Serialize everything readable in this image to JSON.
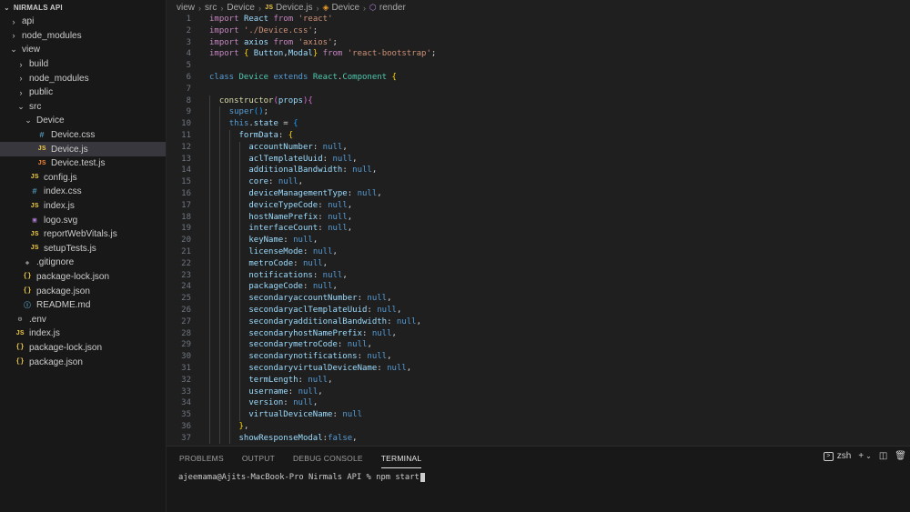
{
  "explorer": {
    "title": "NIRMALS API",
    "items": [
      {
        "label": "api",
        "depth": 1,
        "type": "folder",
        "open": false
      },
      {
        "label": "node_modules",
        "depth": 1,
        "type": "folder",
        "open": false
      },
      {
        "label": "view",
        "depth": 1,
        "type": "folder",
        "open": true
      },
      {
        "label": "build",
        "depth": 2,
        "type": "folder",
        "open": false
      },
      {
        "label": "node_modules",
        "depth": 2,
        "type": "folder",
        "open": false
      },
      {
        "label": "public",
        "depth": 2,
        "type": "folder",
        "open": false
      },
      {
        "label": "src",
        "depth": 2,
        "type": "folder",
        "open": true
      },
      {
        "label": "Device",
        "depth": 3,
        "type": "folder",
        "open": true
      },
      {
        "label": "Device.css",
        "depth": 4,
        "type": "css"
      },
      {
        "label": "Device.js",
        "depth": 4,
        "type": "js",
        "selected": true
      },
      {
        "label": "Device.test.js",
        "depth": 4,
        "type": "test"
      },
      {
        "label": "config.js",
        "depth": 3,
        "type": "js"
      },
      {
        "label": "index.css",
        "depth": 3,
        "type": "css"
      },
      {
        "label": "index.js",
        "depth": 3,
        "type": "js"
      },
      {
        "label": "logo.svg",
        "depth": 3,
        "type": "svg"
      },
      {
        "label": "reportWebVitals.js",
        "depth": 3,
        "type": "js"
      },
      {
        "label": "setupTests.js",
        "depth": 3,
        "type": "js"
      },
      {
        "label": ".gitignore",
        "depth": 2,
        "type": "git"
      },
      {
        "label": "package-lock.json",
        "depth": 2,
        "type": "json"
      },
      {
        "label": "package.json",
        "depth": 2,
        "type": "json"
      },
      {
        "label": "README.md",
        "depth": 2,
        "type": "info"
      },
      {
        "label": ".env",
        "depth": 1,
        "type": "env"
      },
      {
        "label": "index.js",
        "depth": 1,
        "type": "js"
      },
      {
        "label": "package-lock.json",
        "depth": 1,
        "type": "json"
      },
      {
        "label": "package.json",
        "depth": 1,
        "type": "json"
      }
    ]
  },
  "breadcrumb": {
    "parts": [
      "view",
      "src",
      "Device"
    ],
    "file": "Device.js",
    "class": "Device",
    "method": "render"
  },
  "code_lines": [
    [
      [
        "kw2",
        "import"
      ],
      [
        "p",
        " "
      ],
      [
        "v",
        "React"
      ],
      [
        "p",
        " "
      ],
      [
        "kw2",
        "from"
      ],
      [
        "p",
        " "
      ],
      [
        "s",
        "'react'"
      ]
    ],
    [
      [
        "kw2",
        "import"
      ],
      [
        "p",
        " "
      ],
      [
        "s",
        "'./Device.css'"
      ],
      [
        "p",
        ";"
      ]
    ],
    [
      [
        "kw2",
        "import"
      ],
      [
        "p",
        " "
      ],
      [
        "v",
        "axios"
      ],
      [
        "p",
        " "
      ],
      [
        "kw2",
        "from"
      ],
      [
        "p",
        " "
      ],
      [
        "s",
        "'axios'"
      ],
      [
        "p",
        ";"
      ]
    ],
    [
      [
        "kw2",
        "import"
      ],
      [
        "p",
        " "
      ],
      [
        "b1",
        "{"
      ],
      [
        "p",
        " "
      ],
      [
        "v",
        "Button"
      ],
      [
        "p",
        ","
      ],
      [
        "v",
        "Modal"
      ],
      [
        "b1",
        "}"
      ],
      [
        "p",
        " "
      ],
      [
        "kw2",
        "from"
      ],
      [
        "p",
        " "
      ],
      [
        "s",
        "'react-bootstrap'"
      ],
      [
        "p",
        ";"
      ]
    ],
    [],
    [
      [
        "kw",
        "class"
      ],
      [
        "p",
        " "
      ],
      [
        "c",
        "Device"
      ],
      [
        "p",
        " "
      ],
      [
        "kw",
        "extends"
      ],
      [
        "p",
        " "
      ],
      [
        "c",
        "React"
      ],
      [
        "p",
        "."
      ],
      [
        "c",
        "Component"
      ],
      [
        "p",
        " "
      ],
      [
        "b1",
        "{"
      ]
    ],
    [],
    [
      [
        "p",
        "  "
      ],
      [
        "f",
        "constructor"
      ],
      [
        "b2",
        "("
      ],
      [
        "v",
        "props"
      ],
      [
        "b2",
        ")"
      ],
      [
        "b2",
        "{"
      ]
    ],
    [
      [
        "p",
        "    "
      ],
      [
        "kw",
        "super"
      ],
      [
        "b3",
        "("
      ],
      [
        "b3",
        ")"
      ],
      [
        "p",
        ";"
      ]
    ],
    [
      [
        "p",
        "    "
      ],
      [
        "kw",
        "this"
      ],
      [
        "p",
        "."
      ],
      [
        "v",
        "state"
      ],
      [
        "p",
        " = "
      ],
      [
        "b3",
        "{"
      ]
    ],
    [
      [
        "p",
        "      "
      ],
      [
        "v",
        "formData"
      ],
      [
        "p",
        ": "
      ],
      [
        "b1",
        "{"
      ]
    ],
    [
      [
        "p",
        "        "
      ],
      [
        "v",
        "accountNumber"
      ],
      [
        "p",
        ": "
      ],
      [
        "kw",
        "null"
      ],
      [
        "p",
        ","
      ]
    ],
    [
      [
        "p",
        "        "
      ],
      [
        "v",
        "aclTemplateUuid"
      ],
      [
        "p",
        ": "
      ],
      [
        "kw",
        "null"
      ],
      [
        "p",
        ","
      ]
    ],
    [
      [
        "p",
        "        "
      ],
      [
        "v",
        "additionalBandwidth"
      ],
      [
        "p",
        ": "
      ],
      [
        "kw",
        "null"
      ],
      [
        "p",
        ","
      ]
    ],
    [
      [
        "p",
        "        "
      ],
      [
        "v",
        "core"
      ],
      [
        "p",
        ": "
      ],
      [
        "kw",
        "null"
      ],
      [
        "p",
        ","
      ]
    ],
    [
      [
        "p",
        "        "
      ],
      [
        "v",
        "deviceManagementType"
      ],
      [
        "p",
        ": "
      ],
      [
        "kw",
        "null"
      ],
      [
        "p",
        ","
      ]
    ],
    [
      [
        "p",
        "        "
      ],
      [
        "v",
        "deviceTypeCode"
      ],
      [
        "p",
        ": "
      ],
      [
        "kw",
        "null"
      ],
      [
        "p",
        ","
      ]
    ],
    [
      [
        "p",
        "        "
      ],
      [
        "v",
        "hostNamePrefix"
      ],
      [
        "p",
        ": "
      ],
      [
        "kw",
        "null"
      ],
      [
        "p",
        ","
      ]
    ],
    [
      [
        "p",
        "        "
      ],
      [
        "v",
        "interfaceCount"
      ],
      [
        "p",
        ": "
      ],
      [
        "kw",
        "null"
      ],
      [
        "p",
        ","
      ]
    ],
    [
      [
        "p",
        "        "
      ],
      [
        "v",
        "keyName"
      ],
      [
        "p",
        ": "
      ],
      [
        "kw",
        "null"
      ],
      [
        "p",
        ","
      ]
    ],
    [
      [
        "p",
        "        "
      ],
      [
        "v",
        "licenseMode"
      ],
      [
        "p",
        ": "
      ],
      [
        "kw",
        "null"
      ],
      [
        "p",
        ","
      ]
    ],
    [
      [
        "p",
        "        "
      ],
      [
        "v",
        "metroCode"
      ],
      [
        "p",
        ": "
      ],
      [
        "kw",
        "null"
      ],
      [
        "p",
        ","
      ]
    ],
    [
      [
        "p",
        "        "
      ],
      [
        "v",
        "notifications"
      ],
      [
        "p",
        ": "
      ],
      [
        "kw",
        "null"
      ],
      [
        "p",
        ","
      ]
    ],
    [
      [
        "p",
        "        "
      ],
      [
        "v",
        "packageCode"
      ],
      [
        "p",
        ": "
      ],
      [
        "kw",
        "null"
      ],
      [
        "p",
        ","
      ]
    ],
    [
      [
        "p",
        "        "
      ],
      [
        "v",
        "secondaryaccountNumber"
      ],
      [
        "p",
        ": "
      ],
      [
        "kw",
        "null"
      ],
      [
        "p",
        ","
      ]
    ],
    [
      [
        "p",
        "        "
      ],
      [
        "v",
        "secondaryaclTemplateUuid"
      ],
      [
        "p",
        ": "
      ],
      [
        "kw",
        "null"
      ],
      [
        "p",
        ","
      ]
    ],
    [
      [
        "p",
        "        "
      ],
      [
        "v",
        "secondaryadditionalBandwidth"
      ],
      [
        "p",
        ": "
      ],
      [
        "kw",
        "null"
      ],
      [
        "p",
        ","
      ]
    ],
    [
      [
        "p",
        "        "
      ],
      [
        "v",
        "secondaryhostNamePrefix"
      ],
      [
        "p",
        ": "
      ],
      [
        "kw",
        "null"
      ],
      [
        "p",
        ","
      ]
    ],
    [
      [
        "p",
        "        "
      ],
      [
        "v",
        "secondarymetroCode"
      ],
      [
        "p",
        ": "
      ],
      [
        "kw",
        "null"
      ],
      [
        "p",
        ","
      ]
    ],
    [
      [
        "p",
        "        "
      ],
      [
        "v",
        "secondarynotifications"
      ],
      [
        "p",
        ": "
      ],
      [
        "kw",
        "null"
      ],
      [
        "p",
        ","
      ]
    ],
    [
      [
        "p",
        "        "
      ],
      [
        "v",
        "secondaryvirtualDeviceName"
      ],
      [
        "p",
        ": "
      ],
      [
        "kw",
        "null"
      ],
      [
        "p",
        ","
      ]
    ],
    [
      [
        "p",
        "        "
      ],
      [
        "v",
        "termLength"
      ],
      [
        "p",
        ": "
      ],
      [
        "kw",
        "null"
      ],
      [
        "p",
        ","
      ]
    ],
    [
      [
        "p",
        "        "
      ],
      [
        "v",
        "username"
      ],
      [
        "p",
        ": "
      ],
      [
        "kw",
        "null"
      ],
      [
        "p",
        ","
      ]
    ],
    [
      [
        "p",
        "        "
      ],
      [
        "v",
        "version"
      ],
      [
        "p",
        ": "
      ],
      [
        "kw",
        "null"
      ],
      [
        "p",
        ","
      ]
    ],
    [
      [
        "p",
        "        "
      ],
      [
        "v",
        "virtualDeviceName"
      ],
      [
        "p",
        ": "
      ],
      [
        "kw",
        "null"
      ]
    ],
    [
      [
        "p",
        "      "
      ],
      [
        "b1",
        "}"
      ],
      [
        "p",
        ","
      ]
    ],
    [
      [
        "p",
        "      "
      ],
      [
        "v",
        "showResponseModal"
      ],
      [
        "p",
        ":"
      ],
      [
        "kw",
        "false"
      ],
      [
        "p",
        ","
      ]
    ]
  ],
  "panel": {
    "tabs": [
      "PROBLEMS",
      "OUTPUT",
      "DEBUG CONSOLE",
      "TERMINAL"
    ],
    "active_tab": "TERMINAL",
    "shell": "zsh",
    "prompt": "ajeemama@Ajits-MacBook-Pro Nirmals API % ",
    "command": "npm start"
  },
  "colors": {
    "editor_bg": "#1f1f1f",
    "sidebar_bg": "#181818",
    "keyword": "#569cd6",
    "string": "#ce9178",
    "variable": "#9cdcfe",
    "class": "#4ec9b0",
    "function": "#dcdcaa"
  }
}
